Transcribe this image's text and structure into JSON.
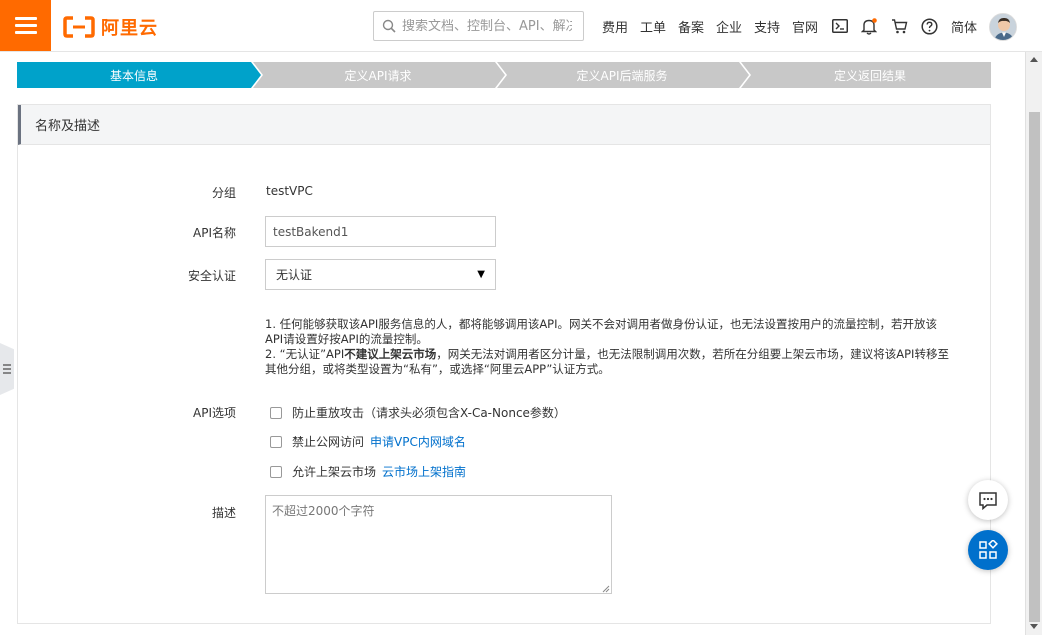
{
  "header": {
    "brand": "阿里云",
    "search_placeholder": "搜索文档、控制台、API、解决方案和资源",
    "nav": [
      "费用",
      "工单",
      "备案",
      "企业",
      "支持",
      "官网"
    ],
    "language": "简体"
  },
  "steps": [
    "基本信息",
    "定义API请求",
    "定义API后端服务",
    "定义返回结果"
  ],
  "panel": {
    "title": "名称及描述",
    "group_label": "分组",
    "group_value": "testVPC",
    "api_name_label": "API名称",
    "api_name_value": "testBakend1",
    "auth_label": "安全认证",
    "auth_value": "无认证",
    "note_line1": "1. 任何能够获取该API服务信息的人，都将能够调用该API。网关不会对调用者做身份认证，也无法设置按用户的流量控制，若开放该API请设置好按API的流量控制。",
    "note_line2_a": "2. “无认证”API",
    "note_line2_b": "不建议上架云市场",
    "note_line2_c": "，网关无法对调用者区分计量，也无法限制调用次数，若所在分组要上架云市场，建议将该API转移至其他分组，或将类型设置为“私有”，或选择“阿里云APP”认证方式。",
    "options_label": "API选项",
    "option1": "防止重放攻击（请求头必须包含X-Ca-Nonce参数）",
    "option2": "禁止公网访问",
    "option2_link": "申请VPC内网域名",
    "option3": "允许上架云市场",
    "option3_link": "云市场上架指南",
    "desc_label": "描述",
    "desc_placeholder": "不超过2000个字符"
  },
  "colors": {
    "brand": "#ff6a00",
    "step_active": "#00a2ca",
    "step_inactive": "#c8c8c8",
    "link": "#0070cc",
    "float_primary": "#0070cc"
  }
}
